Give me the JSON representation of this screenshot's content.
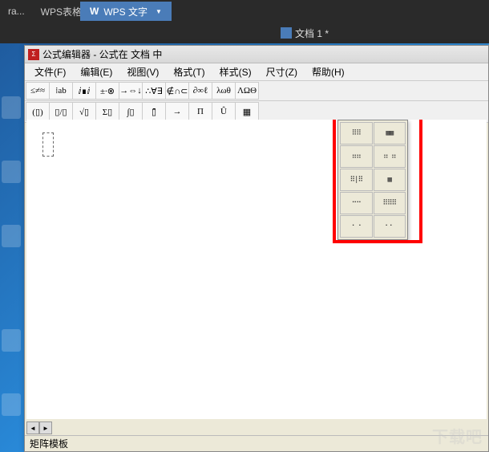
{
  "taskbar": {
    "app_truncated": "ra...",
    "app_name": "WPS表格"
  },
  "wps_tab": {
    "icon": "W",
    "label": "WPS 文字"
  },
  "doc_tab": {
    "name": "文档 1 *"
  },
  "editor": {
    "title": "公式编辑器 - 公式在 文档 中",
    "menus": {
      "file": "文件(F)",
      "edit": "编辑(E)",
      "view": "视图(V)",
      "format": "格式(T)",
      "style": "样式(S)",
      "size": "尺寸(Z)",
      "help": "帮助(H)"
    },
    "toolbar1": {
      "relations": "≤≠≈",
      "spaces": "⁞ab",
      "embellish": "ⅈ∎ⅈ",
      "operators": "±∙⊗",
      "arrows": "→⇔↓",
      "logical": "∴∀∃",
      "set": "∉∩⊂",
      "misc": "∂∞ℓ",
      "greek_lower": "λωθ",
      "greek_upper": "ΛΩΘ"
    },
    "toolbar2": {
      "fence": "(▯)",
      "frac": "▯/▯",
      "root": "√▯",
      "sum": "Σ▯",
      "integral": "∫▯",
      "bar": "▯̄",
      "arrow_over": "→",
      "prod": "Π",
      "hat": "Û",
      "matrix": "▦"
    },
    "matrix_palette": [
      "⠿⠿",
      "▦▦",
      "⠶⠶",
      "⠶ ⠶",
      "⠿|⠿",
      "▦",
      "⠒⠒",
      "⠿⠿⠿",
      "⠂⠐",
      "⠂⠂"
    ],
    "status": "矩阵模板"
  },
  "watermark": "下载吧"
}
